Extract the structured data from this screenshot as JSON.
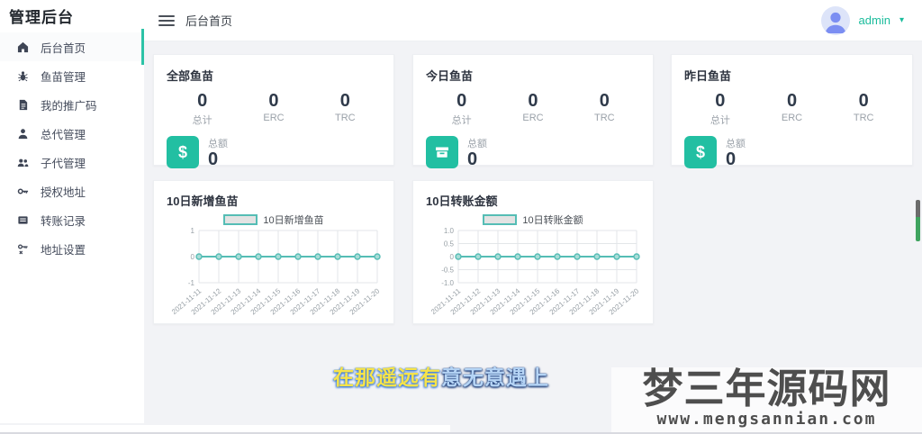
{
  "app": {
    "title": "管理后台"
  },
  "topbar": {
    "breadcrumb": "后台首页",
    "user_name": "admin",
    "caret": "▾"
  },
  "sidebar": {
    "items": [
      {
        "label": "后台首页",
        "icon": "home-icon",
        "active": true
      },
      {
        "label": "鱼苗管理",
        "icon": "bug-icon",
        "active": false
      },
      {
        "label": "我的推广码",
        "icon": "document-icon",
        "active": false
      },
      {
        "label": "总代管理",
        "icon": "person-icon",
        "active": false
      },
      {
        "label": "子代管理",
        "icon": "people-icon",
        "active": false
      },
      {
        "label": "授权地址",
        "icon": "key-icon",
        "active": false
      },
      {
        "label": "转账记录",
        "icon": "list-card-icon",
        "active": false
      },
      {
        "label": "地址设置",
        "icon": "key-x-icon",
        "active": false
      }
    ]
  },
  "stat_cards": [
    {
      "title": "全部鱼苗",
      "icon": "dollar-icon",
      "stats": [
        {
          "value": "0",
          "label": "总计"
        },
        {
          "value": "0",
          "label": "ERC"
        },
        {
          "value": "0",
          "label": "TRC"
        }
      ],
      "total": {
        "label": "总额",
        "value": "0"
      }
    },
    {
      "title": "今日鱼苗",
      "icon": "archive-icon",
      "stats": [
        {
          "value": "0",
          "label": "总计"
        },
        {
          "value": "0",
          "label": "ERC"
        },
        {
          "value": "0",
          "label": "TRC"
        }
      ],
      "total": {
        "label": "总额",
        "value": "0"
      }
    },
    {
      "title": "昨日鱼苗",
      "icon": "dollar-icon",
      "stats": [
        {
          "value": "0",
          "label": "总计"
        },
        {
          "value": "0",
          "label": "ERC"
        },
        {
          "value": "0",
          "label": "TRC"
        }
      ],
      "total": {
        "label": "总额",
        "value": "0"
      }
    }
  ],
  "chart_data": [
    {
      "type": "line",
      "title": "10日新增鱼苗",
      "legend": "10日新增鱼苗",
      "categories": [
        "2021-11-11",
        "2021-11-12",
        "2021-11-13",
        "2021-11-14",
        "2021-11-15",
        "2021-11-16",
        "2021-11-17",
        "2021-11-18",
        "2021-11-19",
        "2021-11-20"
      ],
      "values": [
        0,
        0,
        0,
        0,
        0,
        0,
        0,
        0,
        0,
        0
      ],
      "yticks": [
        "1",
        "0",
        "-1"
      ],
      "ylim": [
        -1,
        1
      ],
      "grid": true,
      "legend_position": "top"
    },
    {
      "type": "line",
      "title": "10日转账金额",
      "legend": "10日转账金额",
      "categories": [
        "2021-11-11",
        "2021-11-12",
        "2021-11-13",
        "2021-11-14",
        "2021-11-15",
        "2021-11-16",
        "2021-11-17",
        "2021-11-18",
        "2021-11-19",
        "2021-11-20"
      ],
      "values": [
        0,
        0,
        0,
        0,
        0,
        0,
        0,
        0,
        0,
        0
      ],
      "yticks": [
        "1.0",
        "0.5",
        "0",
        "-0.5",
        "-1.0"
      ],
      "ylim": [
        -1,
        1
      ],
      "grid": true,
      "legend_position": "top"
    }
  ],
  "watermark": {
    "title": "梦三年源码网",
    "url": "www.mengsannian.com"
  },
  "subtitle": {
    "part1": "在那遥远有",
    "part2": "意无意遇上"
  },
  "colors": {
    "accent": "#1abc9c",
    "chart_line": "#55bdb5",
    "marker_fill": "#a9dcd7",
    "grid": "#e3e6e9",
    "axis_text": "#98a0a6",
    "scrollbar_green": "#3fa35f"
  }
}
